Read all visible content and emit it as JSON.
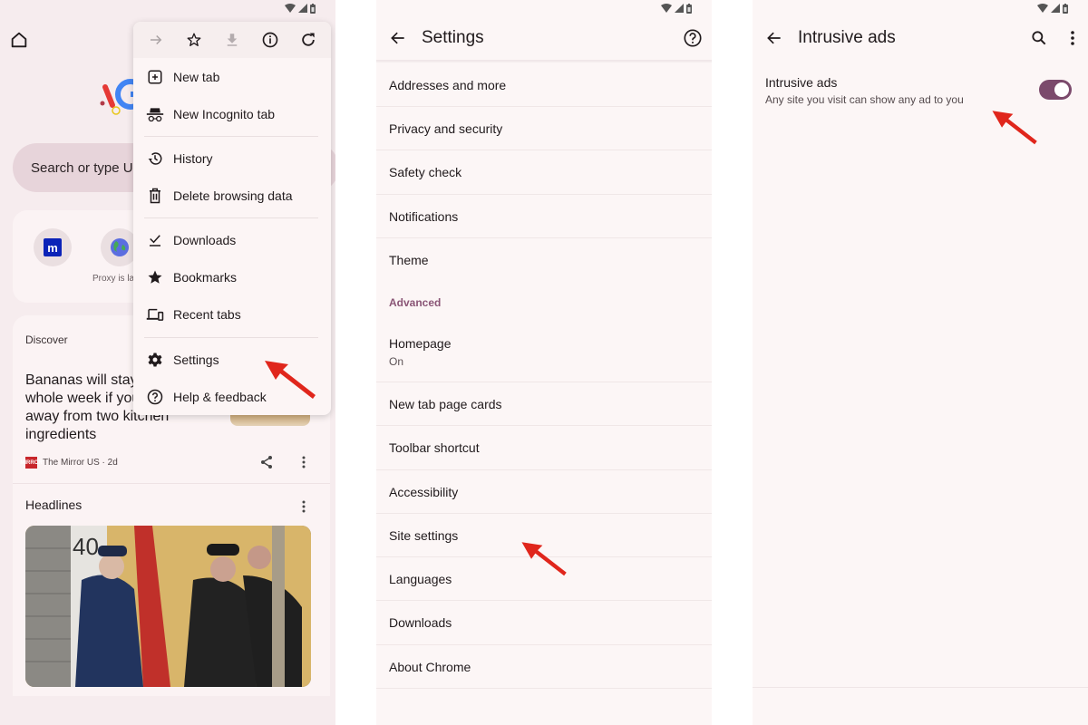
{
  "status_bar": {
    "icons": [
      "wifi-icon",
      "signal-icon",
      "battery-icon"
    ]
  },
  "colors": {
    "accent": "#7b4a6c",
    "section_header": "#8a5576",
    "annotation_arrow": "#e0261c",
    "panel_bg": "#fcf6f6",
    "ntp_bg": "#f6ecee",
    "omnibox_bg": "#e7d4da"
  },
  "ntp": {
    "omnibox_placeholder": "Search or type URL",
    "shortcuts": [
      {
        "icon": "site-m-icon",
        "label": ""
      },
      {
        "icon": "globe-icon",
        "label": "Proxy is la"
      }
    ],
    "feed": {
      "title": "Discover",
      "article": {
        "title": "Bananas will stay fresh for a whole week if you keep them away from two kitchen ingredients",
        "title_visible": "Bananas will sta a whole week if them away from two kitchen ingredients",
        "source": "The Mirror US · 2d",
        "source_logo": "MIRROR"
      },
      "headlines_title": "Headlines"
    }
  },
  "app_menu": {
    "top_actions": [
      {
        "icon": "forward-icon",
        "enabled": false
      },
      {
        "icon": "bookmark-star-icon",
        "enabled": true
      },
      {
        "icon": "download-icon",
        "enabled": false
      },
      {
        "icon": "info-icon",
        "enabled": true
      },
      {
        "icon": "reload-icon",
        "enabled": true
      }
    ],
    "items": [
      {
        "label": "New tab",
        "icon": "new-tab-icon"
      },
      {
        "label": "New Incognito tab",
        "icon": "incognito-icon"
      },
      {
        "label": "History",
        "icon": "history-icon"
      },
      {
        "label": "Delete browsing data",
        "icon": "trash-icon"
      },
      {
        "label": "Downloads",
        "icon": "downloads-icon"
      },
      {
        "label": "Bookmarks",
        "icon": "star-icon"
      },
      {
        "label": "Recent tabs",
        "icon": "devices-icon"
      },
      {
        "label": "Settings",
        "icon": "gear-icon"
      },
      {
        "label": "Help & feedback",
        "icon": "help-icon"
      }
    ]
  },
  "settings": {
    "title": "Settings",
    "items": [
      {
        "label": "Addresses and more"
      },
      {
        "label": "Privacy and security"
      },
      {
        "label": "Safety check"
      },
      {
        "label": "Notifications"
      },
      {
        "label": "Theme"
      }
    ],
    "advanced_header": "Advanced",
    "advanced_items": [
      {
        "label": "Homepage",
        "sub": "On"
      },
      {
        "label": "New tab page cards"
      },
      {
        "label": "Toolbar shortcut"
      },
      {
        "label": "Accessibility"
      },
      {
        "label": "Site settings"
      },
      {
        "label": "Languages"
      },
      {
        "label": "Downloads"
      },
      {
        "label": "About Chrome"
      }
    ]
  },
  "intrusive_ads": {
    "title": "Intrusive ads",
    "setting": {
      "label": "Intrusive ads",
      "description": "Any site you visit can show any ad to you",
      "enabled": true
    }
  }
}
